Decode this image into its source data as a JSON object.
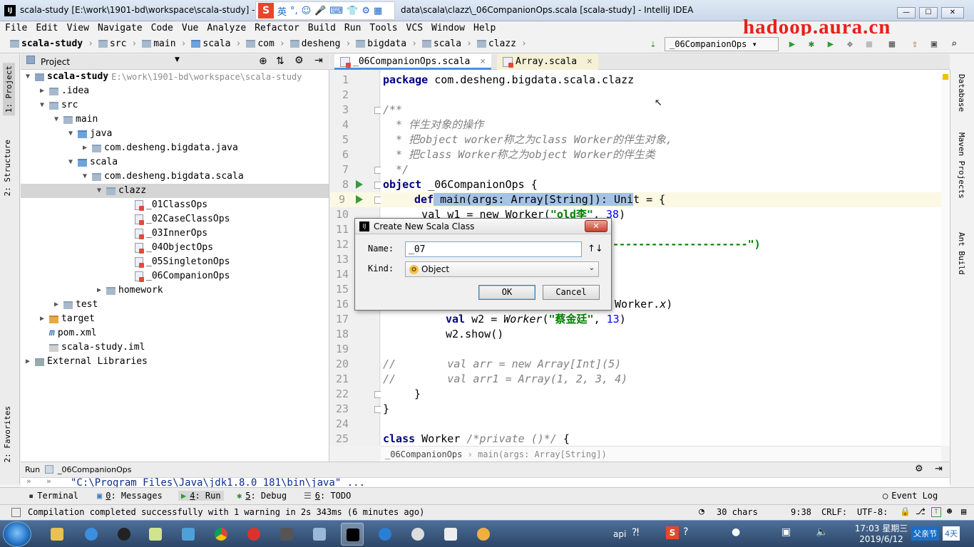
{
  "window": {
    "title_left": "scala-study [E:\\work\\1901-bd\\workspace\\scala-study] - ...",
    "title_right": "data\\scala\\clazz\\_06CompanionOps.scala [scala-study] - IntelliJ IDEA",
    "app_icon": "IJ",
    "min": "—",
    "max": "☐",
    "close": "✕"
  },
  "ime": {
    "logo": "S",
    "lang": "英",
    "items": [
      "°,",
      "☺",
      "🎤",
      "⌨",
      "👕",
      "⚙",
      "▦"
    ]
  },
  "watermark": "hadoop.aura.cn",
  "menu": [
    "File",
    "Edit",
    "View",
    "Navigate",
    "Code",
    "Vue",
    "Analyze",
    "Refactor",
    "Build",
    "Run",
    "Tools",
    "VCS",
    "Window",
    "Help"
  ],
  "breadcrumbs": [
    "scala-study",
    "src",
    "main",
    "scala",
    "com",
    "desheng",
    "bigdata",
    "scala",
    "clazz"
  ],
  "run_config": "_06CompanionOps ▾",
  "left_tabs": {
    "project": "1: Project",
    "structure": "2: Structure",
    "favorites": "2: Favorites"
  },
  "right_tabs": {
    "database": "Database",
    "maven": "Maven Projects",
    "ant": "Ant Build"
  },
  "project": {
    "header": "Project",
    "tree": [
      {
        "label": "scala-study",
        "extra": "E:\\work\\1901-bd\\workspace\\scala-study",
        "depth": 0,
        "arrow": "▼",
        "kind": "module"
      },
      {
        "label": ".idea",
        "depth": 1,
        "arrow": "▶",
        "kind": "folder"
      },
      {
        "label": "src",
        "depth": 1,
        "arrow": "▼",
        "kind": "folder"
      },
      {
        "label": "main",
        "depth": 2,
        "arrow": "▼",
        "kind": "folder"
      },
      {
        "label": "java",
        "depth": 3,
        "arrow": "▼",
        "kind": "blue"
      },
      {
        "label": "com.desheng.bigdata.java",
        "depth": 4,
        "arrow": "▶",
        "kind": "folder"
      },
      {
        "label": "scala",
        "depth": 3,
        "arrow": "▼",
        "kind": "blue"
      },
      {
        "label": "com.desheng.bigdata.scala",
        "depth": 4,
        "arrow": "▼",
        "kind": "folder"
      },
      {
        "label": "clazz",
        "depth": 5,
        "arrow": "▼",
        "kind": "folder",
        "selected": true
      },
      {
        "label": "_01ClassOps",
        "depth": 7,
        "arrow": "",
        "kind": "file"
      },
      {
        "label": "_02CaseClassOps",
        "depth": 7,
        "arrow": "",
        "kind": "file"
      },
      {
        "label": "_03InnerOps",
        "depth": 7,
        "arrow": "",
        "kind": "file"
      },
      {
        "label": "_04ObjectOps",
        "depth": 7,
        "arrow": "",
        "kind": "file"
      },
      {
        "label": "_05SingletonOps",
        "depth": 7,
        "arrow": "",
        "kind": "file"
      },
      {
        "label": "_06CompanionOps",
        "depth": 7,
        "arrow": "",
        "kind": "file"
      },
      {
        "label": "homework",
        "depth": 5,
        "arrow": "▶",
        "kind": "folder"
      },
      {
        "label": "test",
        "depth": 2,
        "arrow": "▶",
        "kind": "folder"
      },
      {
        "label": "target",
        "depth": 1,
        "arrow": "▶",
        "kind": "orange"
      },
      {
        "label": "pom.xml",
        "depth": 1,
        "arrow": "",
        "kind": "maven"
      },
      {
        "label": "scala-study.iml",
        "depth": 1,
        "arrow": "",
        "kind": "iml"
      },
      {
        "label": "External Libraries",
        "depth": 0,
        "arrow": "▶",
        "kind": "lib"
      }
    ]
  },
  "tabs": [
    {
      "label": "_06CompanionOps.scala",
      "active": true
    },
    {
      "label": "Array.scala",
      "active": false
    }
  ],
  "code": {
    "line_numbers": [
      "1",
      "2",
      "3",
      "4",
      "5",
      "6",
      "7",
      "8",
      "9",
      "10",
      "11",
      "12",
      "13",
      "14",
      "15",
      "16",
      "17",
      "18",
      "19",
      "20",
      "21",
      "22",
      "23",
      "24",
      "25"
    ],
    "l1_kw": "package",
    "l1_rest": " com.desheng.bigdata.scala.clazz",
    "l3": "/**",
    "l4": "  * 伴生对象的操作",
    "l5": "  * 把object worker称之为class Worker的伴生对象,",
    "l6": "  * 把class Worker称之为object Worker的伴生类",
    "l7": "  */",
    "l8_kw": "object",
    "l8_rest": " _06CompanionOps {",
    "l9_kw": "def",
    "l9_sel": " main(args: Array[String]): Uni",
    "l9_rest": "t = {",
    "l10_pre": "      val w1 = new Worker(",
    "l10_str": "\"old李\"",
    "l10_mid": ", ",
    "l10_num": "38",
    "l10_end": ")",
    "l12_str": "---------------------\")",
    "l16_rest": "Worker.",
    "l16_it": "x",
    "l16_end": ")",
    "l17_kw": "val",
    "l17_mid": " w2 = ",
    "l17_it": "Worker",
    "l17_open": "(",
    "l17_str": "\"蔡金廷\"",
    "l17_sep": ", ",
    "l17_num": "13",
    "l17_end": ")",
    "l18": "w2.show()",
    "l20": "//        val arr = new Array[Int](5)",
    "l21": "//        val arr1 = Array(1, 2, 3, 4)",
    "l22": "}",
    "l23": "}",
    "l25_kw": "class",
    "l25_mid": " Worker ",
    "l25_cm": "/*private ()*/",
    "l25_end": " {"
  },
  "editor_breadcrumb": {
    "a": "_06CompanionOps",
    "b": "main(args: Array[String])"
  },
  "run_bar": {
    "label": "Run",
    "config": "_06CompanionOps"
  },
  "console_line": "\"C:\\Program Files\\Java\\jdk1.8.0_181\\bin\\java\" ...",
  "tool_windows": [
    {
      "label": "Terminal",
      "ul": ""
    },
    {
      "label": ": Messages",
      "ul": "0"
    },
    {
      "label": ": Run",
      "ul": "4"
    },
    {
      "label": ": Debug",
      "ul": "5"
    },
    {
      "label": ": TODO",
      "ul": "6"
    }
  ],
  "event_log": "Event Log",
  "status": {
    "message": "Compilation completed successfully with 1 warning in 2s 343ms (6 minutes ago)",
    "chars": "30 chars",
    "pos": "9:38",
    "crlf": "CRLF:",
    "enc": "UTF-8:"
  },
  "dialog": {
    "title": "Create New Scala Class",
    "name_label": "Name:",
    "name_value": "_07",
    "kind_label": "Kind:",
    "kind_value": "Object",
    "kind_badge": "O",
    "ok": "OK",
    "cancel": "Cancel",
    "sort": "↑↓"
  },
  "taskbar": {
    "tray_text": "api",
    "time": "17:03 星期三",
    "date": "2019/6/12",
    "holiday": "父亲节",
    "days": "4天"
  }
}
